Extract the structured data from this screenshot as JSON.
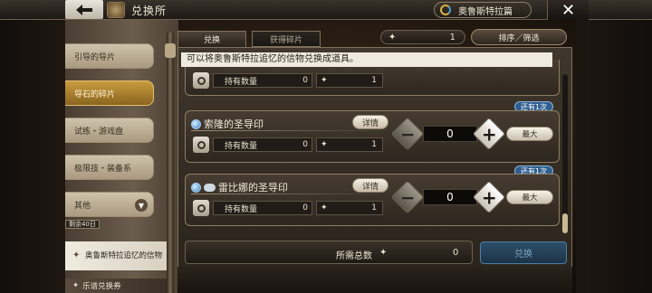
{
  "header": {
    "title": "兑换所",
    "event_button": "奥鲁斯特拉篇",
    "close": "✕"
  },
  "sidebar": {
    "items": [
      {
        "label": "引导的导片"
      },
      {
        "label": "导石的碎片"
      },
      {
        "label": "试练・游戏盘"
      },
      {
        "label": "极限技・装备系"
      },
      {
        "label": "其他"
      }
    ],
    "sub_badge": "剩余40日",
    "sub_item": "奥鲁斯特拉追忆的信物",
    "sub_item2": "乐谱兑换券"
  },
  "tabs": {
    "exchange": "兑换",
    "obtain": "获得碎片"
  },
  "holdings": {
    "value": "1"
  },
  "sort_label": "排序／筛选",
  "info_text": "可以将奥鲁斯特拉追忆的信物兑换成道具。",
  "labels": {
    "held": "持有数量",
    "detail": "详情",
    "max": "最大",
    "minus": "−",
    "plus": "+"
  },
  "cards": [
    {
      "held": "0",
      "cost": "1"
    },
    {
      "name": "索隆的圣导印",
      "remaining": "还有1次",
      "held": "0",
      "cost": "1",
      "qty": "0"
    },
    {
      "name": "雷比娜的圣导印",
      "remaining": "还有1次",
      "held": "0",
      "cost": "1",
      "qty": "0"
    }
  ],
  "total": {
    "label": "所需总数",
    "value": "0"
  },
  "exchange_button": "兑换"
}
